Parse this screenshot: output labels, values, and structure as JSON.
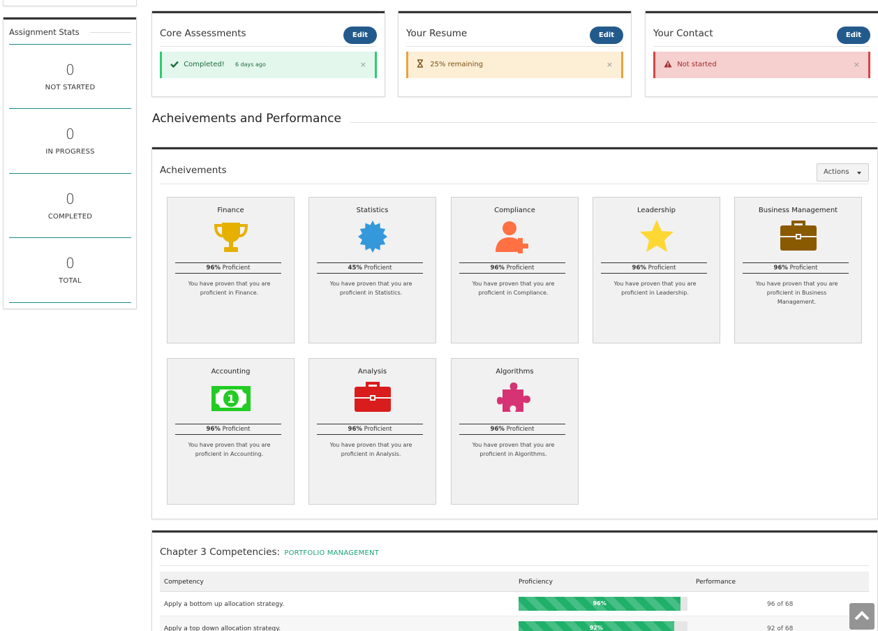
{
  "sidebar": {
    "stats_title": "Assignment Stats",
    "stats": [
      {
        "value": "0",
        "label": "NOT STARTED"
      },
      {
        "value": "0",
        "label": "IN PROGRESS"
      },
      {
        "value": "0",
        "label": "COMPLETED"
      },
      {
        "value": "0",
        "label": "TOTAL"
      }
    ]
  },
  "status_panels": [
    {
      "title": "Core Assessments",
      "edit_label": "Edit",
      "alert_type": "success",
      "icon": "check-icon",
      "alert_text": "Completed!",
      "alert_time": "6 days ago",
      "close": "×"
    },
    {
      "title": "Your Resume",
      "edit_label": "Edit",
      "alert_type": "warning",
      "icon": "hourglass-icon",
      "alert_text": "25% remaining",
      "close": "×"
    },
    {
      "title": "Your Contact",
      "edit_label": "Edit",
      "alert_type": "danger",
      "icon": "warning-triangle-icon",
      "alert_text": "Not started",
      "close": "×"
    }
  ],
  "section_heading": "Acheivements and Performance",
  "achievements": {
    "title": "Acheivements",
    "actions_label": "Actions",
    "cards": [
      {
        "title": "Finance",
        "icon": "trophy-icon",
        "color": "#e5b000",
        "percent": "96%",
        "suffix": "Proficient",
        "desc": "You have proven that you are proficient in Finance."
      },
      {
        "title": "Statistics",
        "icon": "badge-icon",
        "color": "#3498db",
        "percent": "45%",
        "suffix": "Proficient",
        "desc": "You have proven that you are proficient in Statistics."
      },
      {
        "title": "Compliance",
        "icon": "user-plus-icon",
        "color": "#ff7043",
        "percent": "96%",
        "suffix": "Proficient",
        "desc": "You have proven that you are proficient in Compliance."
      },
      {
        "title": "Leadership",
        "icon": "star-icon",
        "color": "#fdd835",
        "percent": "96%",
        "suffix": "Proficient",
        "desc": "You have proven that you are proficient in Leadership."
      },
      {
        "title": "Business Management",
        "icon": "briefcase-icon",
        "color": "#8a5a00",
        "percent": "96%",
        "suffix": "Proficient",
        "desc": "You have proven that you are proficient in Business Management."
      },
      {
        "title": "Accounting",
        "icon": "money-icon",
        "color": "#22cc22",
        "percent": "96%",
        "suffix": "Proficient",
        "desc": "You have proven that you are proficient in Accounting."
      },
      {
        "title": "Analysis",
        "icon": "briefcase-icon",
        "color": "#d91c1c",
        "percent": "96%",
        "suffix": "Proficient",
        "desc": "You have proven that you are proficient in Analysis."
      },
      {
        "title": "Algorithms",
        "icon": "puzzle-icon",
        "color": "#d63374",
        "percent": "96%",
        "suffix": "Proficient",
        "desc": "You have proven that you are proficient in Algorithms."
      }
    ]
  },
  "competencies": {
    "title": "Chapter 3 Competencies:",
    "subtitle": "PORTFOLIO MANAGEMENT",
    "headers": [
      "Competency",
      "Proficiency",
      "Performance"
    ],
    "rows": [
      {
        "competency": "Apply a bottom up allocation strategy.",
        "proficiency": "96%",
        "proficiency_value": 96,
        "performance": "96 of 68"
      },
      {
        "competency": "Apply a top down allocation strategy.",
        "proficiency": "92%",
        "proficiency_value": 92,
        "performance": "92 of 68"
      }
    ]
  },
  "scroll_top_icon": "chevron-up-icon"
}
